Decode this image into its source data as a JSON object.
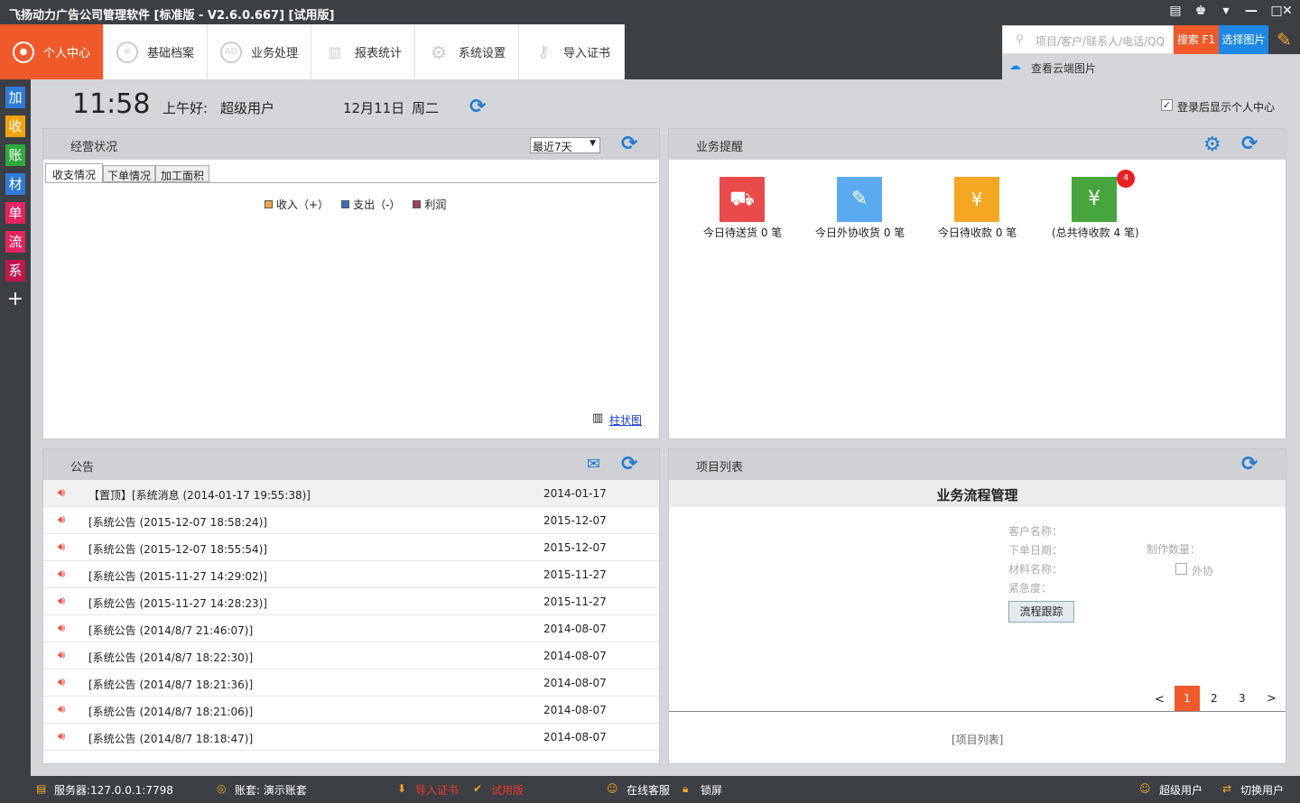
{
  "window": {
    "title": "飞扬动力广告公司管理软件 [标准版 - V2.6.0.667] [试用版]"
  },
  "nav": {
    "items": [
      "个人中心",
      "基础档案",
      "业务处理",
      "报表统计",
      "系统设置",
      "导入证书"
    ],
    "active": 0
  },
  "search": {
    "placeholder": "项目/客户/联系人/电话/QQ",
    "button": "搜索 F1",
    "pick": "选择图片",
    "cloud": "查看云端图片"
  },
  "sidebar": {
    "items": [
      "加",
      "收",
      "账",
      "材",
      "单",
      "流",
      "系"
    ],
    "colors": [
      "#2d7bd6",
      "#f0a30a",
      "#2eaa3c",
      "#2d7bd6",
      "#e0245e",
      "#e0245e",
      "#c0164a"
    ],
    "add": "+"
  },
  "header": {
    "time": "11:58",
    "greeting": "上午好:",
    "user": "超级用户",
    "date": "12月11日",
    "weekday": "周二",
    "show_personal": "登录后显示个人中心"
  },
  "business": {
    "title": "经营状况",
    "range": "最近7天",
    "tabs": [
      "收支情况",
      "下单情况",
      "加工面积"
    ],
    "legend": [
      "收入（+）",
      "支出（-）",
      "利润"
    ],
    "legend_colors": [
      "#f5a54a",
      "#3d6db5",
      "#a0405a"
    ],
    "chart_link": "柱状图"
  },
  "reminder": {
    "title": "业务提醒",
    "items": [
      {
        "label": "今日待送货 0 笔",
        "color": "#e94b4b"
      },
      {
        "label": "今日外协收货 0 笔",
        "color": "#5aaaf0"
      },
      {
        "label": "今日待收款 0 笔",
        "color": "#f5a623"
      },
      {
        "label": "(总共待收款 4 笔)",
        "color": "#46a53c",
        "badge": "4"
      }
    ]
  },
  "notices": {
    "title": "公告",
    "rows": [
      {
        "text": "【置顶】[系统消息 (2014-01-17 19:55:38)]",
        "date": "2014-01-17"
      },
      {
        "text": "[系统公告 (2015-12-07 18:58:24)]",
        "date": "2015-12-07"
      },
      {
        "text": "[系统公告 (2015-12-07 18:55:54)]",
        "date": "2015-12-07"
      },
      {
        "text": "[系统公告 (2015-11-27 14:29:02)]",
        "date": "2015-11-27"
      },
      {
        "text": "[系统公告 (2015-11-27 14:28:23)]",
        "date": "2015-11-27"
      },
      {
        "text": "[系统公告 (2014/8/7 21:46:07)]",
        "date": "2014-08-07"
      },
      {
        "text": "[系统公告 (2014/8/7 18:22:30)]",
        "date": "2014-08-07"
      },
      {
        "text": "[系统公告 (2014/8/7 18:21:36)]",
        "date": "2014-08-07"
      },
      {
        "text": "[系统公告 (2014/8/7 18:21:06)]",
        "date": "2014-08-07"
      },
      {
        "text": "[系统公告 (2014/8/7 18:18:47)]",
        "date": "2014-08-07"
      }
    ]
  },
  "projects": {
    "title": "项目列表",
    "heading": "业务流程管理",
    "fields": {
      "customer": "客户名称：",
      "order_date": "下单日期：",
      "material": "材料名称：",
      "urgency": "紧急度：",
      "qty": "制作数量：",
      "outsource": "外协"
    },
    "track_button": "流程跟踪",
    "pages": [
      "<",
      "1",
      "2",
      "3",
      ">"
    ],
    "footer": "[项目列表]"
  },
  "status": {
    "server": "服务器:127.0.0.1:7798",
    "account": "账套: 演示账套",
    "import": "导入证书",
    "trial": "试用版",
    "service": "在线客服",
    "lock": "锁屏",
    "user": "超级用户",
    "switch": "切换用户"
  }
}
